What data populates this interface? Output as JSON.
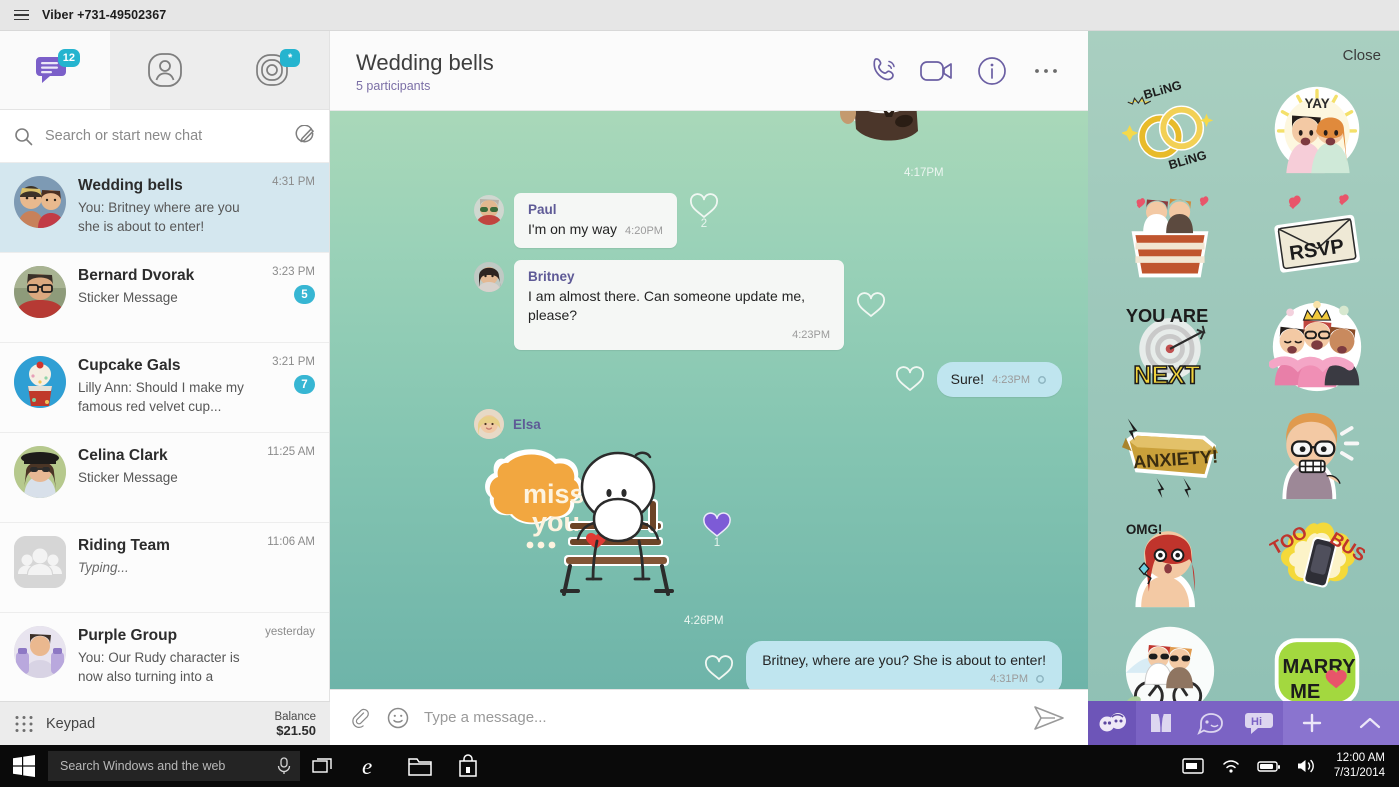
{
  "window": {
    "menu_icon": "hamburger-icon",
    "title": "Viber +731-49502367"
  },
  "sidebar": {
    "tabs": [
      {
        "name": "chats",
        "icon": "chat-bubbles-icon",
        "badge": "12",
        "active": true
      },
      {
        "name": "contacts",
        "icon": "person-icon",
        "badge": "",
        "active": false
      },
      {
        "name": "public-chats",
        "icon": "ripple-icon",
        "badge": "*",
        "active": false
      }
    ],
    "search": {
      "icon": "search-icon",
      "placeholder": "Search or start new chat",
      "value": "",
      "compose_icon": "compose-pencil-icon"
    },
    "chats": [
      {
        "name": "Wedding bells",
        "preview": "You: Britney where are you she is about to enter!",
        "time": "4:31 PM",
        "unread": "",
        "selected": true,
        "avatar": "couple-photo",
        "typing": false
      },
      {
        "name": "Bernard Dvorak",
        "preview": "Sticker Message",
        "time": "3:23 PM",
        "unread": "5",
        "selected": false,
        "avatar": "man-glasses-photo",
        "typing": false
      },
      {
        "name": "Cupcake Gals",
        "preview": "Lilly Ann: Should I make my famous red velvet cup...",
        "time": "3:21 PM",
        "unread": "7",
        "selected": false,
        "avatar": "cupcake-photo",
        "typing": false
      },
      {
        "name": "Celina Clark",
        "preview": "Sticker Message",
        "time": "11:25 AM",
        "unread": "",
        "selected": false,
        "avatar": "woman-hat-photo",
        "typing": false
      },
      {
        "name": "Riding Team",
        "preview": "Typing...",
        "time": "11:06 AM",
        "unread": "",
        "selected": false,
        "avatar": "group-placeholder",
        "typing": true
      },
      {
        "name": "Purple Group",
        "preview": "You: Our Rudy character is now also turning into a",
        "time": "yesterday",
        "unread": "",
        "selected": false,
        "avatar": "purple-photo",
        "typing": false
      }
    ],
    "footer": {
      "keypad_icon": "keypad-dots-icon",
      "keypad_label": "Keypad",
      "balance_label": "Balance",
      "balance_value": "$21.50"
    }
  },
  "chat": {
    "header": {
      "title": "Wedding bells",
      "subtitle": "5 participants",
      "actions": [
        {
          "name": "voice-call",
          "icon": "phone-icon"
        },
        {
          "name": "video-call",
          "icon": "video-camera-icon"
        },
        {
          "name": "chat-info",
          "icon": "info-circle-icon"
        },
        {
          "name": "more-options",
          "icon": "ellipsis-icon"
        }
      ]
    },
    "messages": [
      {
        "id": "m0",
        "type": "sticker",
        "direction": "in",
        "sender": "",
        "text": "",
        "time": "4:17PM",
        "sticker": "bear-tuxedo-sticker",
        "reaction_count": "",
        "reaction_color": ""
      },
      {
        "id": "m1",
        "type": "text",
        "direction": "in",
        "sender": "Paul",
        "text": "I'm on my way",
        "time": "4:20PM",
        "reaction_count": "2",
        "reaction_color": "#f2faf6",
        "avatar": "paul-avatar"
      },
      {
        "id": "m2",
        "type": "text",
        "direction": "in",
        "sender": "Britney",
        "text": "I am almost there. Can someone update me, please?",
        "time": "4:23PM",
        "reaction_count": "",
        "reaction_color": "#f2faf6",
        "avatar": "britney-avatar"
      },
      {
        "id": "m3",
        "type": "text",
        "direction": "out",
        "sender": "",
        "text": "Sure!",
        "time": "4:23PM",
        "status_icon": "seen-icon",
        "reaction_count": "",
        "reaction_color": "#f2faf6"
      },
      {
        "id": "m4",
        "type": "sticker",
        "direction": "in",
        "sender": "Elsa",
        "text": "",
        "time": "4:26PM",
        "sticker": "miss-you-bench-sticker",
        "sticker_text_line1": "miss",
        "sticker_text_line2": "you",
        "sticker_text_line3": "...",
        "reaction_count": "1",
        "reaction_color": "#7d5bd6",
        "avatar": "elsa-avatar"
      },
      {
        "id": "m5",
        "type": "text",
        "direction": "out",
        "sender": "",
        "text": "Britney, where are you? She is about to enter!",
        "time": "4:31PM",
        "status_icon": "seen-icon",
        "reaction_count": "",
        "reaction_color": "#f2faf6"
      }
    ],
    "composer": {
      "attach_icon": "paperclip-icon",
      "emoji_icon": "smiley-icon",
      "placeholder": "Type a message...",
      "value": "",
      "send_icon": "send-paper-plane-icon"
    }
  },
  "sticker_panel": {
    "close_label": "Close",
    "stickers": [
      {
        "name": "bling-rings-sticker",
        "label": "BLiNG BLiNG"
      },
      {
        "name": "yay-brides-sticker",
        "label": "YAY"
      },
      {
        "name": "wedding-cake-sticker",
        "label": ""
      },
      {
        "name": "rsvp-envelope-sticker",
        "label": "RSVP"
      },
      {
        "name": "you-are-next-sticker",
        "label": "YOU ARE NEXT"
      },
      {
        "name": "bachelorette-party-sticker",
        "label": ""
      },
      {
        "name": "anxiety-banner-sticker",
        "label": "ANXIETY!"
      },
      {
        "name": "nervous-guy-sticker",
        "label": ""
      },
      {
        "name": "omg-ring-sticker",
        "label": "OMG!"
      },
      {
        "name": "too-busy-phone-sticker",
        "label": "TOO BUSY"
      },
      {
        "name": "runaway-bride-sticker",
        "label": ""
      },
      {
        "name": "marry-me-sticker",
        "label": "MARRY ME"
      }
    ],
    "toolbar": [
      {
        "name": "recent-stickers-tab",
        "icon": "doodle-face-icon"
      },
      {
        "name": "wedding-pack-tab",
        "icon": "suit-dress-icon"
      },
      {
        "name": "cartoon-pack-tab",
        "icon": "cartoon-face-icon"
      },
      {
        "name": "hi-pack-tab",
        "icon": "hi-bubble-icon",
        "label": "Hi"
      },
      {
        "name": "add-sticker-pack",
        "icon": "plus-icon"
      },
      {
        "name": "collapse-panel",
        "icon": "chevron-up-icon"
      }
    ]
  },
  "taskbar": {
    "start_icon": "windows-logo-icon",
    "search_placeholder": "Search Windows and the web",
    "search_value": "",
    "mic_icon": "microphone-icon",
    "apps": [
      {
        "name": "task-view",
        "icon": "task-view-icon"
      },
      {
        "name": "internet-explorer",
        "icon": "ie-icon"
      },
      {
        "name": "file-explorer",
        "icon": "folder-icon"
      },
      {
        "name": "store",
        "icon": "store-bag-icon"
      }
    ],
    "tray": [
      {
        "name": "action-center",
        "icon": "action-center-icon"
      },
      {
        "name": "network",
        "icon": "wifi-icon"
      },
      {
        "name": "battery",
        "icon": "battery-icon"
      },
      {
        "name": "volume",
        "icon": "speaker-icon"
      }
    ],
    "clock_time": "12:00 AM",
    "clock_date": "7/31/2014"
  }
}
